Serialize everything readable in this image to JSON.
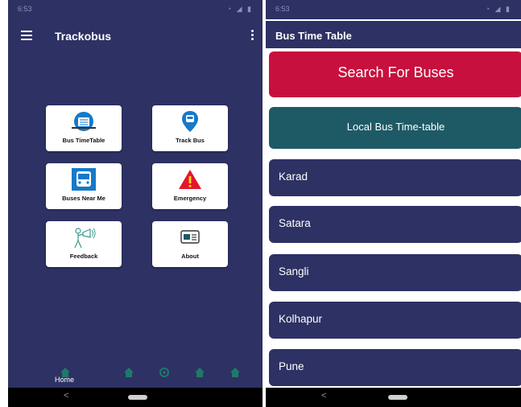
{
  "left_screen": {
    "status_time": "6:53",
    "app_title": "Trackobus",
    "tiles": [
      {
        "label": "Bus TimeTable",
        "icon": "bus-timetable-icon"
      },
      {
        "label": "Track Bus",
        "icon": "location-bus-icon"
      },
      {
        "label": "Buses Near Me",
        "icon": "bus-front-icon"
      },
      {
        "label": "Emergency",
        "icon": "warning-icon"
      },
      {
        "label": "Feedback",
        "icon": "megaphone-person-icon"
      },
      {
        "label": "About",
        "icon": "info-ticket-icon"
      }
    ],
    "bottom_nav": {
      "active_label": "Home"
    }
  },
  "right_screen": {
    "status_time": "6:53",
    "title": "Bus Time Table",
    "search_button": "Search For Buses",
    "local_button": "Local Bus Time-table",
    "cities": [
      "Karad",
      "Satara",
      "Sangli",
      "Kolhapur",
      "Pune"
    ]
  },
  "colors": {
    "navy": "#2e3163",
    "search_red": "#c8103e",
    "local_teal": "#1e5a66",
    "emergency_red": "#e3162b",
    "icon_blue": "#1679c9"
  }
}
